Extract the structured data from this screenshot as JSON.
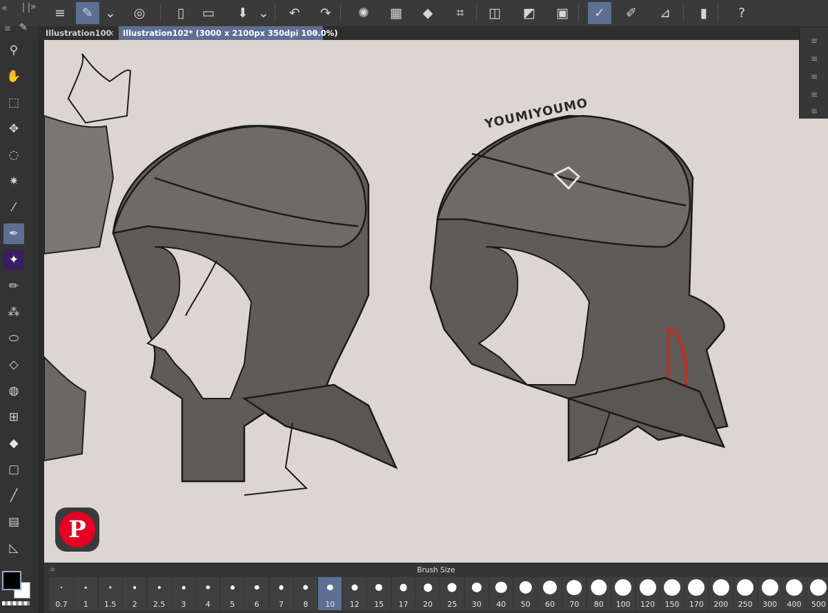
{
  "toolbar": {
    "collapse_icon": "«",
    "menu_icon": "≡",
    "buttons": [
      {
        "name": "pen-settings-icon",
        "glyph": "✎",
        "active": true
      },
      {
        "name": "dropdown-icon",
        "glyph": "⌄"
      },
      {
        "name": "record-icon",
        "glyph": "◎"
      },
      {
        "name": "new-file-icon",
        "glyph": "▯"
      },
      {
        "name": "open-folder-icon",
        "glyph": "▭"
      },
      {
        "name": "save-icon",
        "glyph": "⬇"
      },
      {
        "name": "save-dropdown-icon",
        "glyph": "⌄"
      },
      {
        "name": "undo-icon",
        "glyph": "↶"
      },
      {
        "name": "redo-icon",
        "glyph": "↷"
      },
      {
        "name": "loading-icon",
        "glyph": "✺"
      },
      {
        "name": "selection-clear-icon",
        "glyph": "▦"
      },
      {
        "name": "fill-icon",
        "glyph": "◆"
      },
      {
        "name": "transform-icon",
        "glyph": "⌗"
      },
      {
        "name": "deselect-icon",
        "glyph": "◫"
      },
      {
        "name": "invert-selection-icon",
        "glyph": "◩"
      },
      {
        "name": "selection-border-icon",
        "glyph": "▣"
      },
      {
        "name": "ruler-pen-icon",
        "glyph": "✓",
        "active": true
      },
      {
        "name": "brush-icon",
        "glyph": "✐"
      },
      {
        "name": "line-ruler-icon",
        "glyph": "⊿"
      },
      {
        "name": "device-icon",
        "glyph": "▮"
      },
      {
        "name": "help-icon",
        "glyph": "?"
      }
    ]
  },
  "tabs": [
    {
      "label": "Illustration100",
      "close": "×"
    },
    {
      "label": "Illustration102* (3000 x 2100px 350dpi 100.0%)",
      "close": "•"
    }
  ],
  "tools": [
    {
      "name": "zoom-icon",
      "glyph": "⚲"
    },
    {
      "name": "hand-icon",
      "glyph": "✋"
    },
    {
      "name": "object-select-icon",
      "glyph": "⬚"
    },
    {
      "name": "move-icon",
      "glyph": "✥"
    },
    {
      "name": "lasso-icon",
      "glyph": "◌"
    },
    {
      "name": "magic-wand-icon",
      "glyph": "✷"
    },
    {
      "name": "eyedropper-icon",
      "glyph": "⁄"
    },
    {
      "name": "pen-icon",
      "glyph": "✒",
      "active": true
    },
    {
      "name": "sparkle-icon",
      "glyph": "✦"
    },
    {
      "name": "pencil-icon",
      "glyph": "✏"
    },
    {
      "name": "airbrush-icon",
      "glyph": "⁂"
    },
    {
      "name": "decoration-icon",
      "glyph": "⬭"
    },
    {
      "name": "eraser-icon",
      "glyph": "◇"
    },
    {
      "name": "blend-icon",
      "glyph": "◍"
    },
    {
      "name": "figure-icon",
      "glyph": "⊞"
    },
    {
      "name": "fill-bucket-icon",
      "glyph": "◆"
    },
    {
      "name": "gradient-icon",
      "glyph": "▢"
    },
    {
      "name": "line-icon",
      "glyph": "╱"
    },
    {
      "name": "frame-icon",
      "glyph": "▤"
    },
    {
      "name": "ruler-icon",
      "glyph": "◺"
    }
  ],
  "colors": {
    "main": "#000000",
    "sub": "#ffffff",
    "accent": "#5d6f93"
  },
  "brush_size": {
    "title": "Brush Size",
    "selected": "10",
    "sizes": [
      "0.7",
      "1",
      "1.5",
      "2",
      "2.5",
      "3",
      "4",
      "5",
      "6",
      "7",
      "8",
      "10",
      "12",
      "15",
      "17",
      "20",
      "25",
      "30",
      "40",
      "50",
      "60",
      "70",
      "80",
      "100",
      "120",
      "150",
      "170",
      "200",
      "250",
      "300",
      "400",
      "500"
    ]
  },
  "canvas": {
    "signature": "YOUMIYOUMO",
    "pinterest_badge": "P"
  }
}
